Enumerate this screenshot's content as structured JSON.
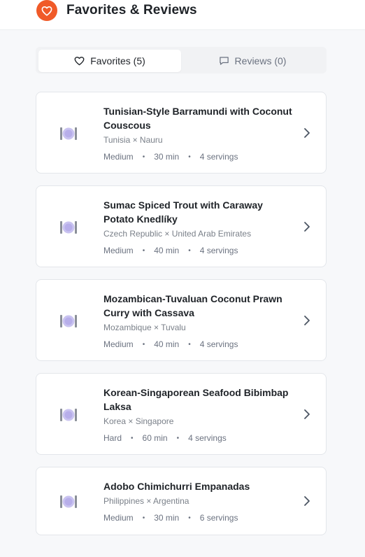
{
  "header": {
    "title": "Favorites & Reviews",
    "icon": "heart-icon",
    "accent": "#f05a28"
  },
  "tabs": [
    {
      "label": "Favorites (5)",
      "icon": "heart-outline-icon",
      "active": true
    },
    {
      "label": "Reviews (0)",
      "icon": "comment-icon",
      "active": false
    }
  ],
  "favorites": [
    {
      "title": "Tunisian-Style Barramundi with Coconut Couscous",
      "origin": "Tunisia × Nauru",
      "difficulty": "Medium",
      "time": "30 min",
      "servings": "4 servings"
    },
    {
      "title": "Sumac Spiced Trout with Caraway Potato Knedlíky",
      "origin": "Czech Republic × United Arab Emirates",
      "difficulty": "Medium",
      "time": "40 min",
      "servings": "4 servings"
    },
    {
      "title": "Mozambican-Tuvaluan Coconut Prawn Curry with Cassava",
      "origin": "Mozambique × Tuvalu",
      "difficulty": "Medium",
      "time": "40 min",
      "servings": "4 servings"
    },
    {
      "title": "Korean-Singaporean Seafood Bibimbap Laksa",
      "origin": "Korea × Singapore",
      "difficulty": "Hard",
      "time": "60 min",
      "servings": "4 servings"
    },
    {
      "title": "Adobo Chimichurri Empanadas",
      "origin": "Philippines × Argentina",
      "difficulty": "Medium",
      "time": "30 min",
      "servings": "6 servings"
    }
  ]
}
